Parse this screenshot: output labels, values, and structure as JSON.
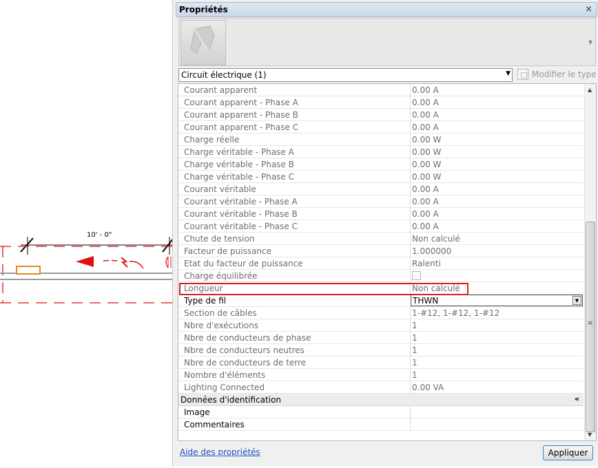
{
  "palette": {
    "title": "Propriétés",
    "close_glyph": "×",
    "type_selector": {
      "value": "Circuit électrique (1)",
      "arrow": "▼"
    },
    "edit_type": {
      "label": "Modifier le type",
      "icon": "edit-type-icon"
    },
    "preview_arrow": "▼",
    "properties": [
      {
        "name": "Courant apparent",
        "value": "0.00 A",
        "readonly": true
      },
      {
        "name": "Courant apparent - Phase A",
        "value": "0.00 A",
        "readonly": true
      },
      {
        "name": "Courant apparent - Phase B",
        "value": "0.00 A",
        "readonly": true
      },
      {
        "name": "Courant apparent - Phase C",
        "value": "0.00 A",
        "readonly": true
      },
      {
        "name": "Charge réelle",
        "value": "0.00 W",
        "readonly": true
      },
      {
        "name": "Charge véritable - Phase A",
        "value": "0.00 W",
        "readonly": true
      },
      {
        "name": "Charge véritable - Phase B",
        "value": "0.00 W",
        "readonly": true
      },
      {
        "name": "Charge véritable - Phase C",
        "value": "0.00 W",
        "readonly": true
      },
      {
        "name": "Courant véritable",
        "value": "0.00 A",
        "readonly": true
      },
      {
        "name": "Courant véritable - Phase A",
        "value": "0.00 A",
        "readonly": true
      },
      {
        "name": "Courant véritable - Phase B",
        "value": "0.00 A",
        "readonly": true
      },
      {
        "name": "Courant véritable - Phase C",
        "value": "0.00 A",
        "readonly": true
      },
      {
        "name": "Chute de tension",
        "value": "Non calculé",
        "readonly": true
      },
      {
        "name": "Facteur de puissance",
        "value": "1.000000",
        "readonly": true
      },
      {
        "name": "Etat du facteur de puissance",
        "value": "Ralenti",
        "readonly": true
      },
      {
        "name": "Charge équilibrée",
        "value": "",
        "readonly": true,
        "checkbox": true
      },
      {
        "name": "Longueur",
        "value": "Non calculé",
        "readonly": true
      }
    ],
    "wire_type": {
      "name": "Type de fil",
      "value": "THWN",
      "arrow": "▼"
    },
    "properties_after": [
      {
        "name": "Section de câbles",
        "value": "1-#12, 1-#12, 1-#12",
        "readonly": true
      },
      {
        "name": "Nbre d'exécutions",
        "value": "1",
        "readonly": true
      },
      {
        "name": "Nbre de conducteurs de phase",
        "value": "1",
        "readonly": true
      },
      {
        "name": "Nbre de conducteurs neutres",
        "value": "1",
        "readonly": true
      },
      {
        "name": "Nbre de conducteurs de terre",
        "value": "1",
        "readonly": true
      },
      {
        "name": "Nombre d'éléments",
        "value": "1",
        "readonly": true
      },
      {
        "name": "Lighting Connected",
        "value": "0.00 VA",
        "readonly": true
      }
    ],
    "group": {
      "name": "Données d'identification",
      "toggle": "«"
    },
    "identity_rows": [
      {
        "name": "Image",
        "value": ""
      },
      {
        "name": "Commentaires",
        "value": ""
      }
    ],
    "scroll": {
      "up": "▲",
      "down": "▼",
      "grip": "≡"
    },
    "help_link": "Aide des propriétés",
    "apply_label": "Appliquer"
  },
  "canvas": {
    "dimension_label": "10' - 0\""
  },
  "colors": {
    "wire": "#e01010",
    "highlight": "#d42020",
    "fixture": "#e08a1a",
    "link": "#1a4fbf"
  }
}
